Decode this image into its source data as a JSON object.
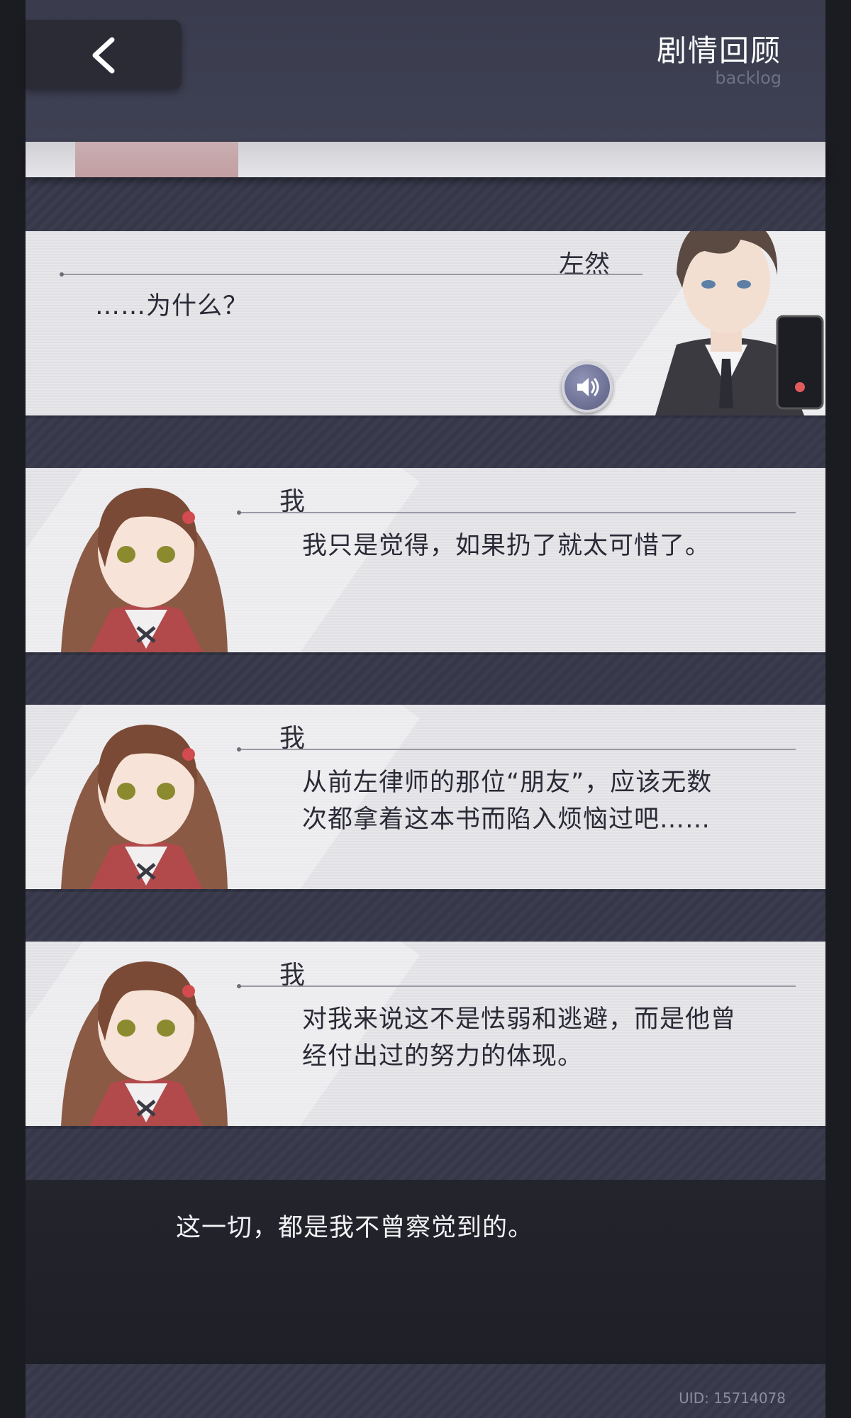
{
  "header": {
    "title": "剧情回顾",
    "subtitle": "backlog"
  },
  "entries": [
    {
      "speaker": "左然",
      "lines": [
        "……为什么？"
      ],
      "has_voice": true
    },
    {
      "speaker": "我",
      "lines": [
        "我只是觉得，如果扔了就太可惜了。"
      ],
      "has_voice": false
    },
    {
      "speaker": "我",
      "lines": [
        "从前左律师的那位“朋友”，应该无数",
        "次都拿着这本书而陷入烦恼过吧……"
      ],
      "has_voice": false
    },
    {
      "speaker": "我",
      "lines": [
        "对我来说这不是怯弱和逃避，而是他曾",
        "经付出过的努力的体现。"
      ],
      "has_voice": false
    }
  ],
  "narration": {
    "text": "这一切，都是我不曾察觉到的。"
  },
  "footer": {
    "uid": "UID: 15714078"
  },
  "icons": {
    "back": "chevron-left-icon",
    "voice": "speaker-icon"
  }
}
